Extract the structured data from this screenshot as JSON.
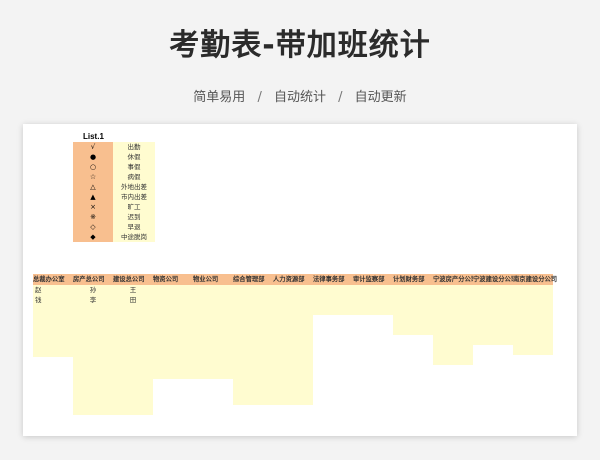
{
  "page": {
    "title": "考勤表-带加班统计",
    "features": [
      "简单易用",
      "自动统计",
      "自动更新"
    ],
    "separator": "/"
  },
  "sheet": {
    "legend_title": "List.1",
    "legend": [
      {
        "symbol": "√",
        "label": "出勤"
      },
      {
        "symbol": "●",
        "label": "休假"
      },
      {
        "symbol": "○",
        "label": "事假"
      },
      {
        "symbol": "☆",
        "label": "病假"
      },
      {
        "symbol": "△",
        "label": "外地出差"
      },
      {
        "symbol": "▲",
        "label": "市内出差"
      },
      {
        "symbol": "×",
        "label": "旷工"
      },
      {
        "symbol": "※",
        "label": "迟到"
      },
      {
        "symbol": "◇",
        "label": "早退"
      },
      {
        "symbol": "◆",
        "label": "中途脱岗"
      }
    ],
    "departments": [
      {
        "name": "总裁办公室",
        "members": [
          "赵",
          "钱"
        ]
      },
      {
        "name": "房产总公司",
        "members": [
          "孙",
          "李"
        ]
      },
      {
        "name": "建设总公司",
        "members": [
          "王",
          "田"
        ]
      },
      {
        "name": "物资公司",
        "members": []
      },
      {
        "name": "物业公司",
        "members": []
      },
      {
        "name": "综合管理部",
        "members": []
      },
      {
        "name": "人力资源部",
        "members": []
      },
      {
        "name": "法律事务部",
        "members": []
      },
      {
        "name": "审计监察部",
        "members": []
      },
      {
        "name": "计划财务部",
        "members": []
      },
      {
        "name": "宁波房产分公司",
        "members": []
      },
      {
        "name": "宁波建设分公司",
        "members": []
      },
      {
        "name": "南京建设分公司",
        "members": []
      }
    ]
  },
  "colors": {
    "header_fill": "#f8bf8f",
    "body_fill": "#fffcd0",
    "background": "#f3f3f3"
  }
}
